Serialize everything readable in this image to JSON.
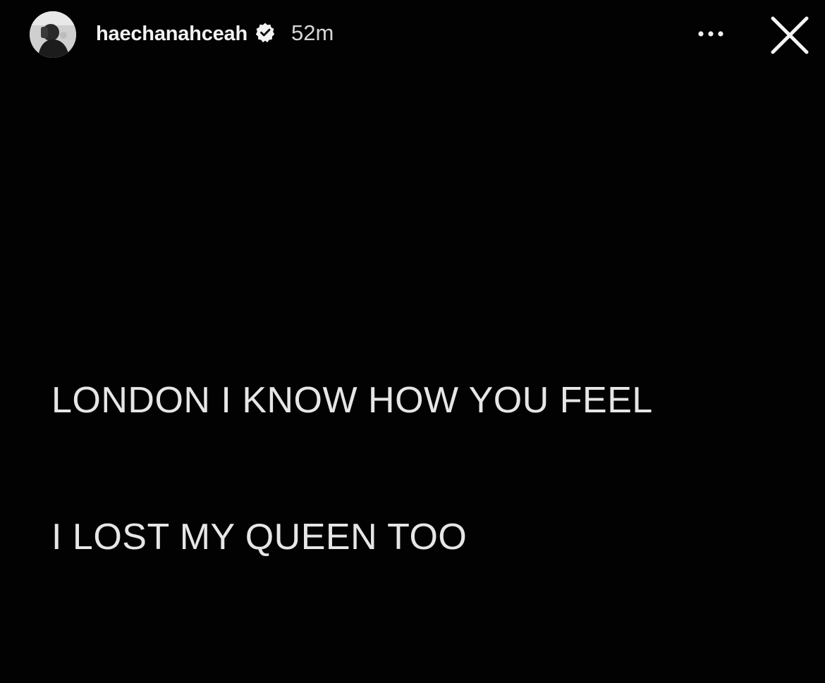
{
  "story": {
    "username": "haechanahceah",
    "verified_icon": "verified-badge-icon",
    "timestamp": "52m",
    "more_icon": "more-options-icon",
    "close_icon": "close-icon",
    "text_lines": [
      "LONDON I KNOW HOW YOU FEEL",
      "I LOST MY QUEEN TOO"
    ]
  },
  "colors": {
    "background": "#020202",
    "text": "#e6e6e6",
    "username": "#f2f2f2"
  }
}
